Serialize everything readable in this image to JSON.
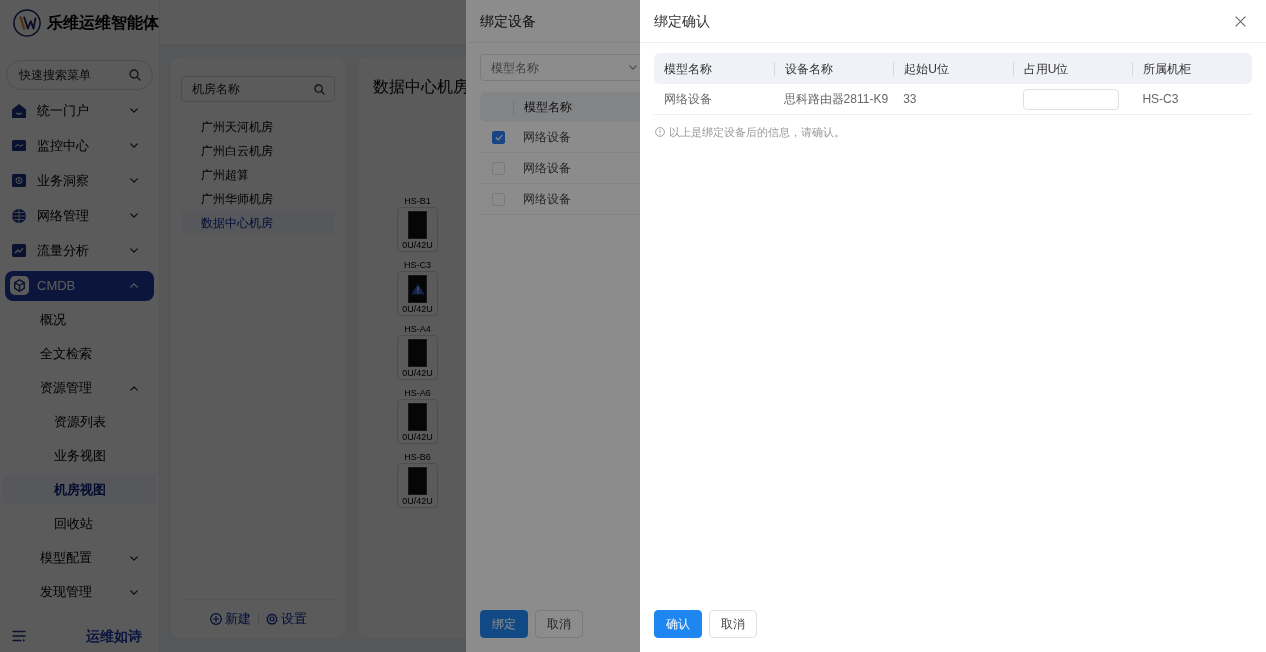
{
  "sidebar": {
    "brand": "乐维运维智能体",
    "search": {
      "placeholder": "快速搜索菜单"
    },
    "menu": [
      {
        "label": "统一门户",
        "expanded": false,
        "selected": false
      },
      {
        "label": "监控中心",
        "expanded": false,
        "selected": false
      },
      {
        "label": "业务洞察",
        "expanded": false,
        "selected": false
      },
      {
        "label": "网络管理",
        "expanded": false,
        "selected": false
      },
      {
        "label": "流量分析",
        "expanded": false,
        "selected": false
      },
      {
        "label": "CMDB",
        "expanded": true,
        "selected": true,
        "children": [
          {
            "label": "概况",
            "selected": false
          },
          {
            "label": "全文检索",
            "selected": false
          },
          {
            "label": "资源管理",
            "expanded": true,
            "selected": false,
            "children": [
              {
                "label": "资源列表",
                "selected": false
              },
              {
                "label": "业务视图",
                "selected": false
              },
              {
                "label": "机房视图",
                "selected": true
              },
              {
                "label": "回收站",
                "selected": false
              }
            ]
          },
          {
            "label": "模型配置",
            "expanded": false,
            "selected": false
          },
          {
            "label": "发现管理",
            "expanded": false,
            "selected": false
          }
        ]
      }
    ],
    "footer_text": "运维如诗"
  },
  "room_panel": {
    "search": {
      "placeholder": "机房名称"
    },
    "rooms": [
      {
        "label": "广州天河机房",
        "selected": false
      },
      {
        "label": "广州白云机房",
        "selected": false
      },
      {
        "label": "广州超算",
        "selected": false
      },
      {
        "label": "广州华师机房",
        "selected": false
      },
      {
        "label": "数据中心机房",
        "selected": true
      }
    ],
    "actions": [
      "新建",
      "设置"
    ]
  },
  "room_view": {
    "title": "数据中心机房",
    "racks": [
      {
        "label": "HS-B1",
        "usage": "0U/42U",
        "warning": false
      },
      {
        "label": "HS-C3",
        "usage": "0U/42U",
        "warning": true
      },
      {
        "label": "HS-A4",
        "usage": "0U/42U",
        "warning": false
      },
      {
        "label": "HS-A6",
        "usage": "0U/42U",
        "warning": false
      },
      {
        "label": "HS-B6",
        "usage": "0U/42U",
        "warning": false
      }
    ]
  },
  "bind_drawer": {
    "title": "绑定设备",
    "filter": {
      "placeholder": "模型名称"
    },
    "table": {
      "columns": [
        "模型名称"
      ],
      "rows": [
        {
          "model_name": "网络设备",
          "checked": true
        },
        {
          "model_name": "网络设备",
          "checked": false
        },
        {
          "model_name": "网络设备",
          "checked": false
        }
      ]
    },
    "buttons": [
      {
        "label": "绑定",
        "kind": "primary"
      },
      {
        "label": "取消",
        "kind": "default"
      }
    ]
  },
  "confirm_drawer": {
    "title": "绑定确认",
    "table": {
      "columns": [
        "模型名称",
        "设备名称",
        "起始U位",
        "占用U位",
        "所属机柜"
      ],
      "rows": [
        {
          "cells": [
            {
              "kind": "text",
              "text": "网络设备"
            },
            {
              "kind": "text",
              "text": "思科路由器2811-K9"
            },
            {
              "kind": "text",
              "text": "33"
            },
            {
              "kind": "input"
            },
            {
              "kind": "text",
              "text": "HS-C3"
            }
          ]
        }
      ]
    },
    "note": "以上是绑定设备后的信息，请确认。",
    "buttons": [
      {
        "label": "确认",
        "kind": "primary"
      },
      {
        "label": "取消",
        "kind": "default"
      }
    ]
  }
}
